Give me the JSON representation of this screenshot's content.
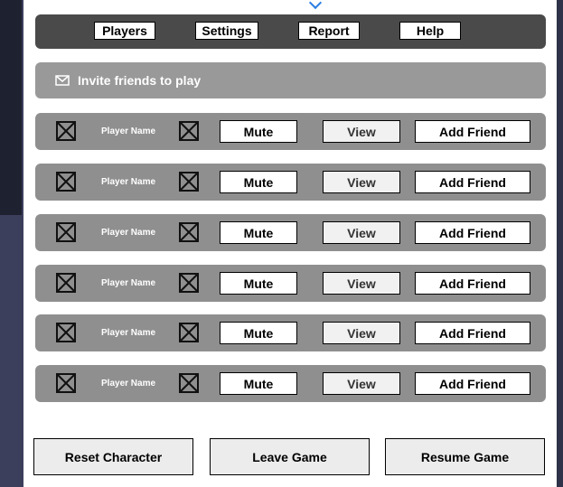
{
  "nav": {
    "players": "Players",
    "settings": "Settings",
    "report": "Report",
    "help": "Help"
  },
  "invite": {
    "label": "Invite friends to play",
    "icon": "envelope-icon"
  },
  "rows": [
    {
      "name": "Player Name",
      "mute": "Mute",
      "view": "View",
      "add": "Add Friend"
    },
    {
      "name": "Player Name",
      "mute": "Mute",
      "view": "View",
      "add": "Add Friend"
    },
    {
      "name": "Player Name",
      "mute": "Mute",
      "view": "View",
      "add": "Add Friend"
    },
    {
      "name": "Player Name",
      "mute": "Mute",
      "view": "View",
      "add": "Add Friend"
    },
    {
      "name": "Player Name",
      "mute": "Mute",
      "view": "View",
      "add": "Add Friend"
    },
    {
      "name": "Player Name",
      "mute": "Mute",
      "view": "View",
      "add": "Add Friend"
    }
  ],
  "footer": {
    "reset": "Reset Character",
    "leave": "Leave Game",
    "resume": "Resume Game"
  },
  "colors": {
    "background": "#3c3f5c",
    "navbar": "#4a4a4a",
    "invite": "#999999",
    "row": "#8f8f8f",
    "accent": "#2a7de1"
  }
}
